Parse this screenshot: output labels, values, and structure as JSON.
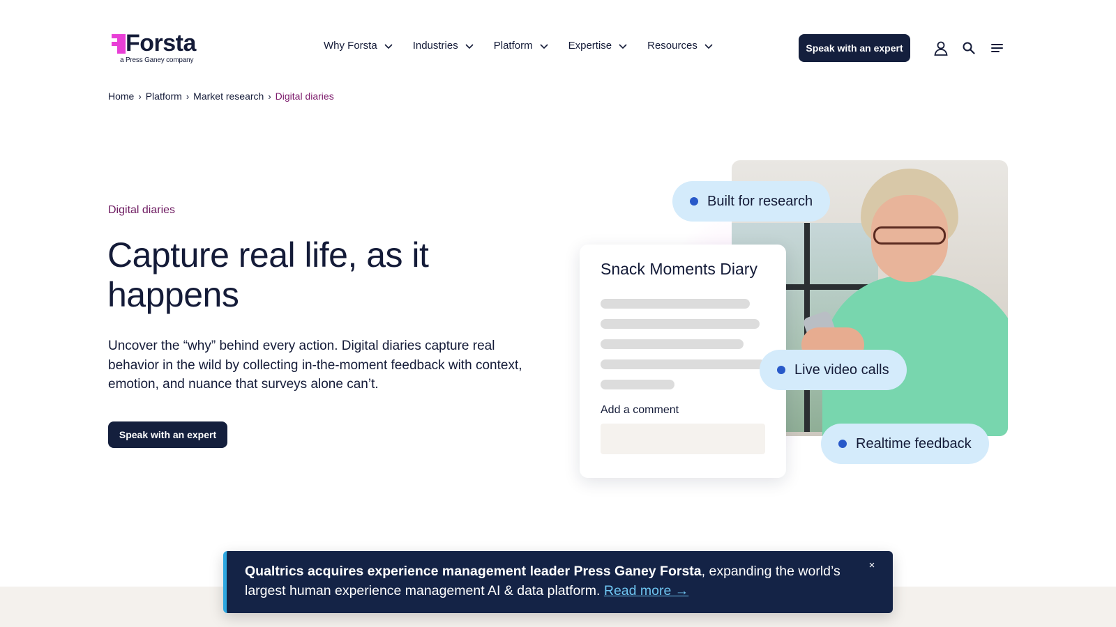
{
  "header": {
    "logo": {
      "wordmark": "Forsta",
      "tagline": "a Press Ganey company",
      "brand_color": "#e83fd6"
    },
    "nav": [
      {
        "label": "Why Forsta",
        "icon": "chevron-down-icon"
      },
      {
        "label": "Industries",
        "icon": "chevron-down-icon"
      },
      {
        "label": "Platform",
        "icon": "chevron-down-icon"
      },
      {
        "label": "Expertise",
        "icon": "chevron-down-icon"
      },
      {
        "label": "Resources",
        "icon": "chevron-down-icon"
      }
    ],
    "cta_label": "Speak with an expert",
    "icons": [
      "user-icon",
      "search-icon",
      "menu-icon"
    ]
  },
  "breadcrumb": {
    "items": [
      "Home",
      "Platform",
      "Market research"
    ],
    "current": "Digital diaries",
    "separator": "›"
  },
  "hero": {
    "eyebrow": "Digital diaries",
    "headline": "Capture real life, as it happens",
    "lede": "Uncover the “why” behind every action. Digital diaries capture real behavior in the wild by collecting in-the-moment feedback with context, emotion, and nuance that surveys alone can’t.",
    "cta_label": "Speak with an expert"
  },
  "visual": {
    "diary_title": "Snack Moments Diary",
    "comment_label": "Add a comment",
    "pills": [
      "Built for research",
      "Live video calls",
      "Realtime feedback"
    ],
    "pill_color": "#d4ebfb",
    "dot_color": "#2859c9"
  },
  "banner": {
    "bold_text": "Qualtrics acquires experience management leader Press Ganey Forsta",
    "text": ", expanding the world’s largest human experience management AI & data platform. ",
    "link_label": "Read more →",
    "close_glyph": "×",
    "accent_color": "#2ea7e0"
  },
  "colors": {
    "navy": "#141f3d",
    "text": "#141b38",
    "eyebrow": "#6e1b61"
  }
}
